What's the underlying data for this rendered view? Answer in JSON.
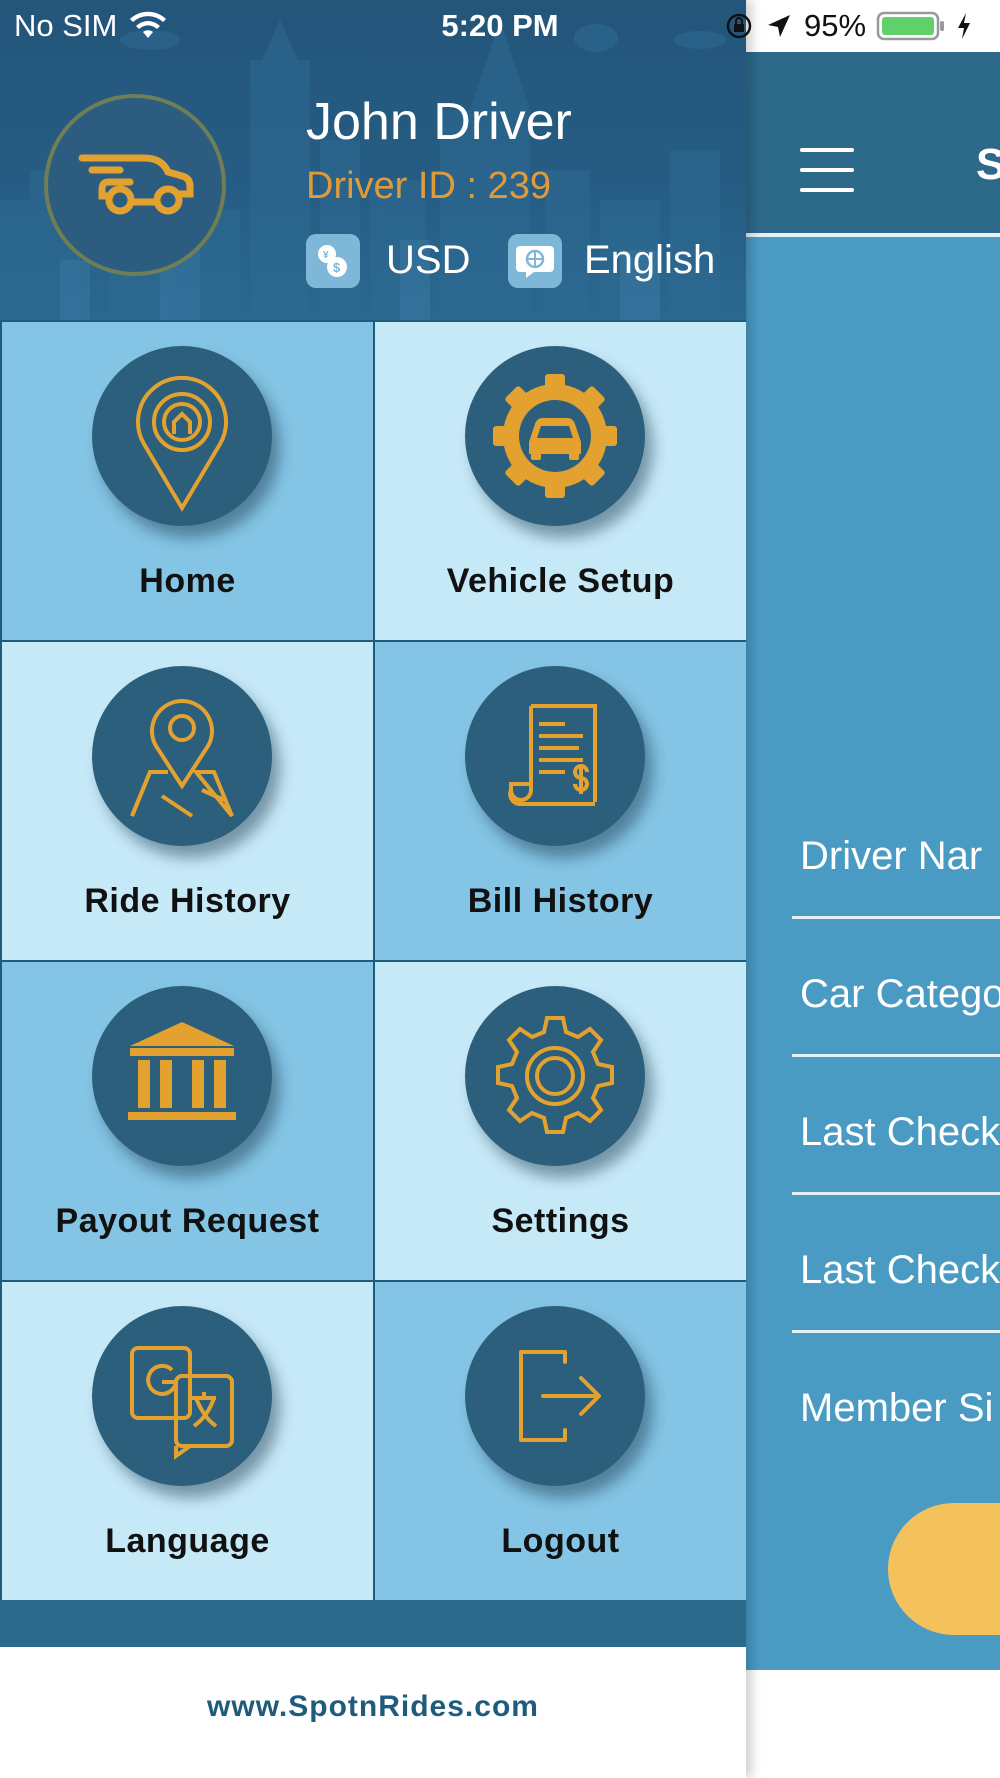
{
  "status_bar": {
    "carrier": "No SIM",
    "time": "5:20 PM",
    "battery": "95%"
  },
  "drawer": {
    "driver_name": "John Driver",
    "driver_id": "Driver ID : 239",
    "currency": "USD",
    "language": "English",
    "menu": [
      {
        "label": "Home",
        "icon": "home-pin-icon"
      },
      {
        "label": "Vehicle Setup",
        "icon": "car-gear-icon"
      },
      {
        "label": "Ride History",
        "icon": "map-pin-icon"
      },
      {
        "label": "Bill History",
        "icon": "receipt-icon"
      },
      {
        "label": "Payout Request",
        "icon": "bank-icon"
      },
      {
        "label": "Settings",
        "icon": "gear-icon"
      },
      {
        "label": "Language",
        "icon": "translate-icon"
      },
      {
        "label": "Logout",
        "icon": "logout-icon"
      }
    ],
    "website": "www.SpotnRides.com"
  },
  "main_screen": {
    "title_partial": "S",
    "fields": [
      {
        "label": "Driver Nar"
      },
      {
        "label": "Car Catego"
      },
      {
        "label": "Last Check"
      },
      {
        "label": "Last Check"
      },
      {
        "label": "Member Si"
      }
    ]
  },
  "colors": {
    "header_blue": "#24557a",
    "tile_dark": "#84c4e4",
    "tile_light": "#c6e9f8",
    "icon_circle": "#2b5f7c",
    "icon_gold": "#e3a22f",
    "main_body": "#4a9bc4",
    "accent_button": "#f4c25c"
  }
}
